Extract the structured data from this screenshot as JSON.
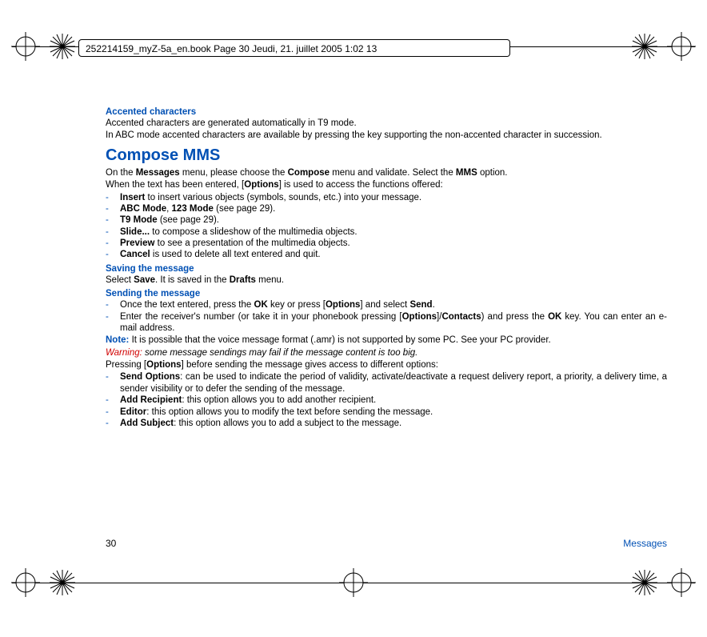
{
  "header": {
    "text": "252214159_myZ-5a_en.book  Page 30  Jeudi, 21. juillet 2005  1:02 13"
  },
  "s1": {
    "accented_h": "Accented characters",
    "accented_p1": "Accented characters are generated automatically in T9 mode.",
    "accented_p2": "In ABC mode accented characters are available by pressing the key supporting the non-accented character in succession."
  },
  "s2": {
    "title": "Compose MMS",
    "intro": "On the <b>Messages</b> menu, please choose the <b>Compose</b> menu and validate. Select the <b>MMS</b> option.",
    "intro2": "When the text has been entered, [<b>Options</b>] is used to access the functions offered:",
    "opts": [
      "<b>Insert</b> to insert various objects (symbols, sounds, etc.) into your message.",
      "<b>ABC Mode</b>, <b>123 Mode</b> (see page 29).",
      "<b>T9 Mode</b> (see page 29).",
      "<b>Slide...</b> to compose a slideshow of the multimedia objects.",
      "<b>Preview</b> to see a presentation of the multimedia objects.",
      "<b>Cancel</b> is used to delete all text entered and quit."
    ],
    "save_h": "Saving the message",
    "save_p": "Select <b>Save</b>. It is saved in the <b>Drafts</b> menu.",
    "send_h": "Sending the message",
    "send_steps": [
      "Once the text entered, press the <b>OK</b> key or press [<b>Options</b>] and select <b>Send</b>.",
      "Enter the receiver's number (or take it in your phonebook pressing [<b>Options</b>]/<b>Contacts</b>) and press the <b>OK</b> key. You can enter an e-mail address."
    ],
    "note_label": "Note:",
    "note_body": " It is possible that the voice message format (.amr) is not supported by some PC. See your PC provider.",
    "warn_label": "Warning:",
    "warn_body": " some message sendings may fail if the message content is too big.",
    "press_opts": "Pressing [<b>Options</b>] before sending the message gives access to different options:",
    "send_opts": [
      "<b>Send Options</b>: can be used to indicate the period of validity, activate/deactivate a request delivery report, a priority, a delivery time, a sender visibility or to defer the sending of the message.",
      "<b>Add Recipient</b>: this option allows you to add another recipient.",
      "<b>Editor</b>: this option allows you to modify the text before sending the message.",
      "<b>Add Subject</b>: this option allows you to add a subject to the message."
    ]
  },
  "footer": {
    "page": "30",
    "label": "Messages"
  }
}
